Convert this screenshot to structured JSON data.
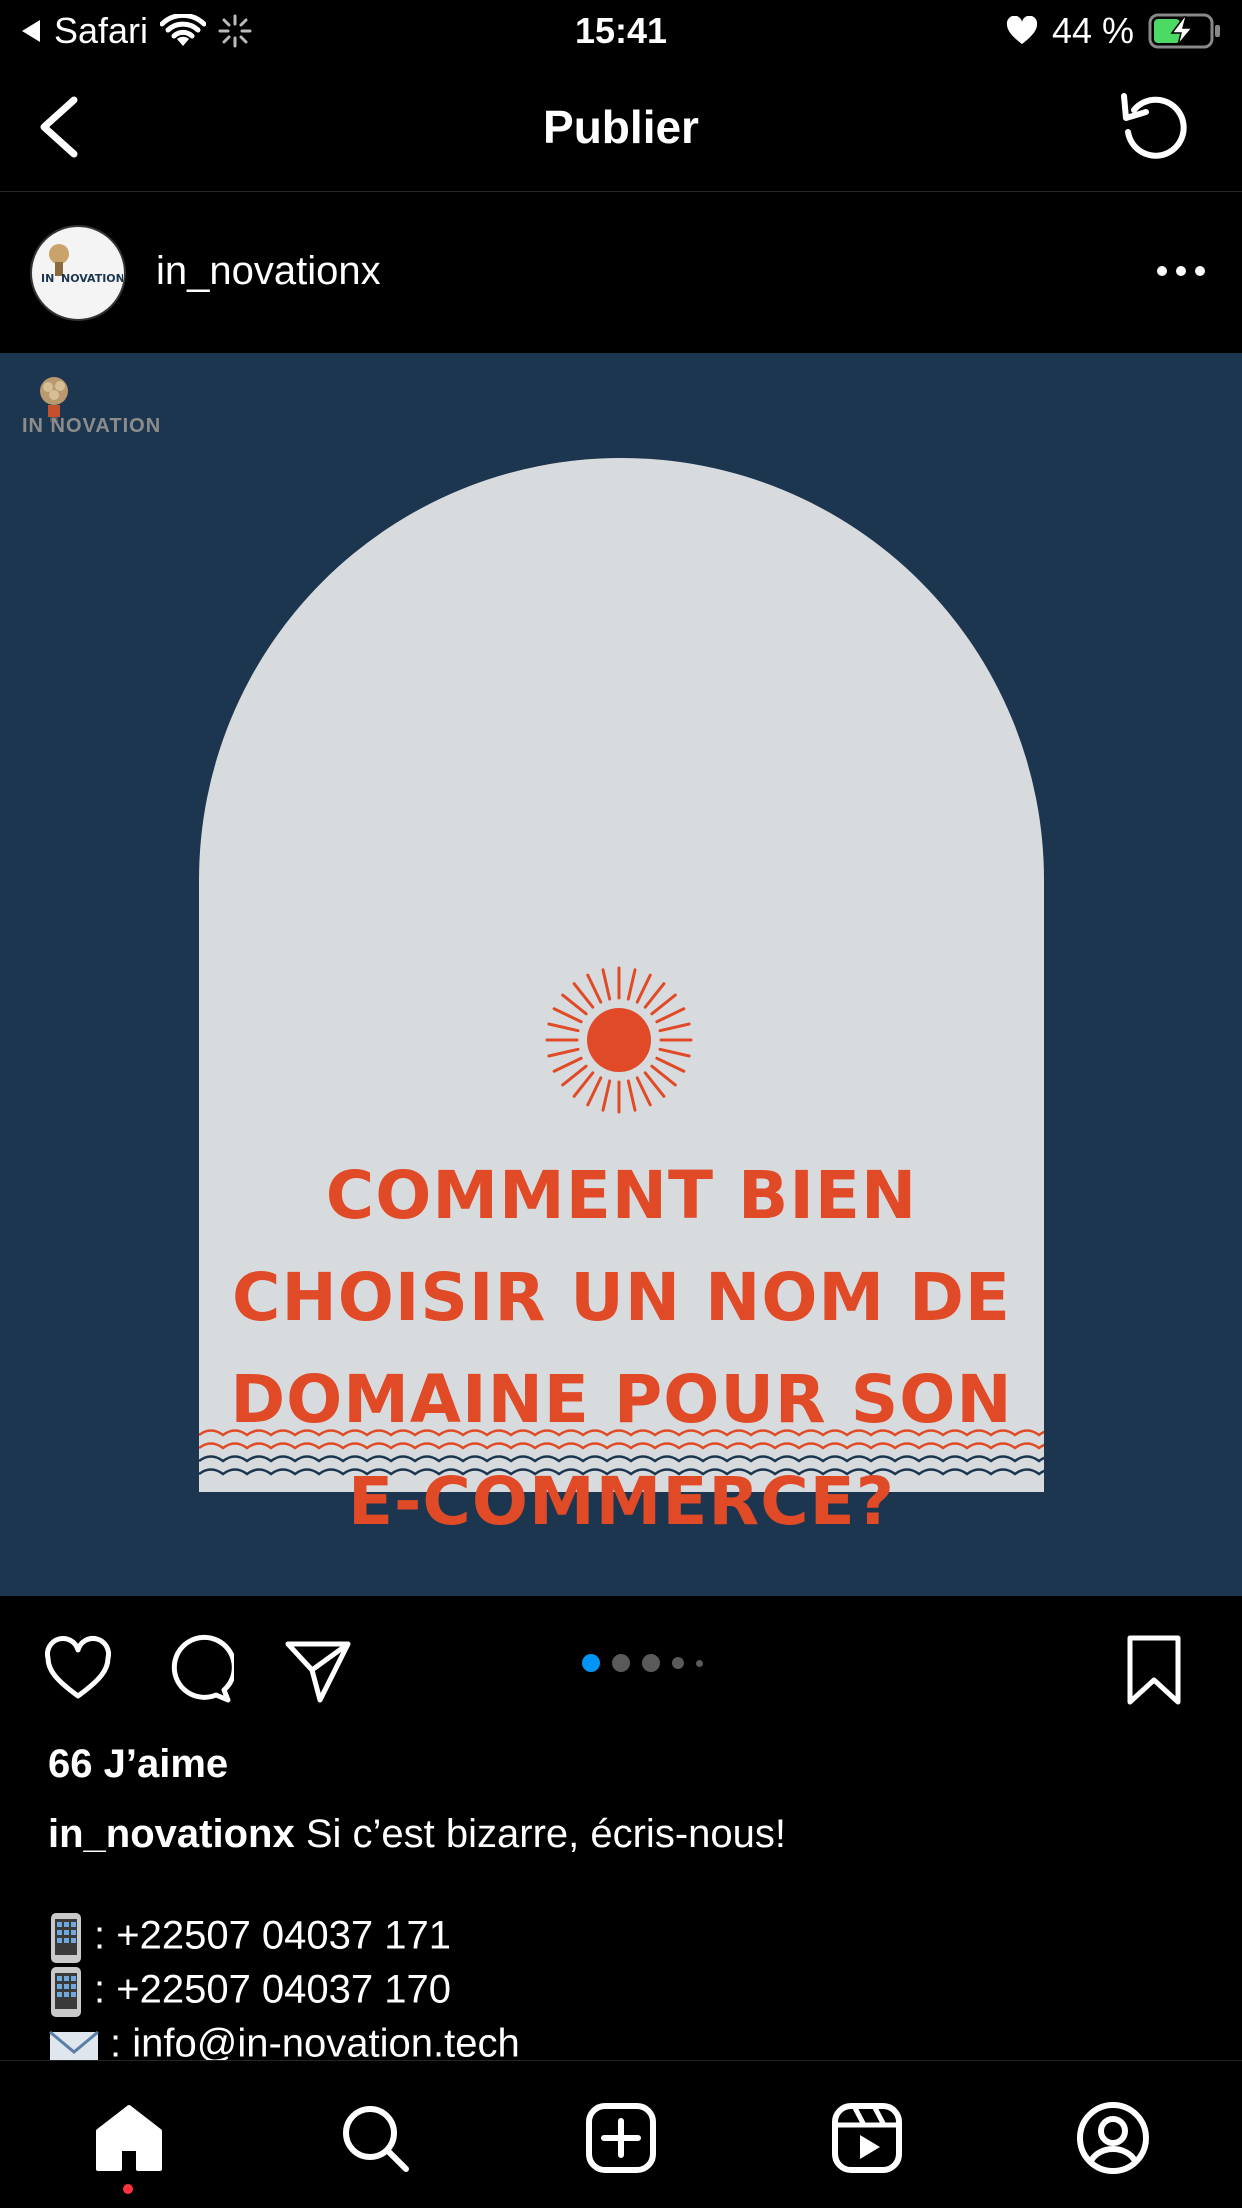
{
  "status_bar": {
    "back_app": "Safari",
    "time": "15:41",
    "battery": "44 %"
  },
  "header": {
    "title": "Publier"
  },
  "post": {
    "username": "in_novationx",
    "image": {
      "logo_text": "IN NOVATION",
      "headline_lines": [
        "COMMENT BIEN",
        "CHOISIR UN NOM DE",
        "DOMAINE POUR SON",
        "E-COMMERCE?"
      ],
      "colors": {
        "background": "#1d3650",
        "arch": "#d8dbde",
        "accent": "#e04a26"
      }
    },
    "carousel": {
      "count": 5,
      "active": 0,
      "active_color": "#0095f6"
    },
    "likes": "66 J’aime",
    "caption_user": "in_novationx",
    "caption_text": "Si c’est bizarre, écris-nous!",
    "contacts": [
      {
        "icon": "mobile-phone-icon",
        "text": ": +22507 04037 171"
      },
      {
        "icon": "mobile-phone-icon",
        "text": ": +22507 04037 170"
      },
      {
        "icon": "envelope-icon",
        "text": ": info@in-novation.tech"
      }
    ]
  },
  "tabbar": {
    "items": [
      "home",
      "search",
      "create",
      "reels",
      "profile"
    ]
  }
}
